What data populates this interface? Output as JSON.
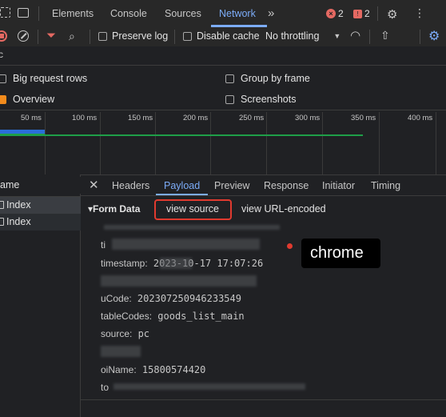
{
  "tabs": [
    "Elements",
    "Console",
    "Sources",
    "Network"
  ],
  "more_tabs": "»",
  "errors_count": "2",
  "warnings_count": "2",
  "toolbar": {
    "preserve_log": "Preserve log",
    "disable_cache": "Disable cache",
    "throttling": "No throttling"
  },
  "settings": {
    "big_request_rows": "Big request rows",
    "group_by_frame": "Group by frame",
    "overview": "Overview",
    "screenshots": "Screenshots"
  },
  "timeline_ticks": [
    "50 ms",
    "100 ms",
    "150 ms",
    "200 ms",
    "250 ms",
    "300 ms",
    "350 ms",
    "400 ms"
  ],
  "request_list": {
    "header": "ame",
    "rows": [
      "Index",
      "Index"
    ]
  },
  "detail_tabs": [
    "Headers",
    "Payload",
    "Preview",
    "Response",
    "Initiator",
    "Timing"
  ],
  "payload": {
    "section": "▾Form Data",
    "view_source": "view source",
    "view_url_encoded": "view URL-encoded",
    "fields": [
      {
        "key": "ti",
        "value": ""
      },
      {
        "key": "timestamp:",
        "value": " 2023-10-17 17:07:26"
      },
      {
        "key": "uCode:",
        "value": " 202307250946233549"
      },
      {
        "key": "tableCodes:",
        "value": " goods_list_main"
      },
      {
        "key": "source:",
        "value": " pc"
      },
      {
        "key": "oiName:",
        "value": " 15800574420"
      },
      {
        "key": "to",
        "value": ""
      }
    ]
  },
  "annotation": "chrome",
  "colors": {
    "accent": "#7cacf8",
    "error": "#e46962",
    "highlight_box": "#e03a2f"
  }
}
